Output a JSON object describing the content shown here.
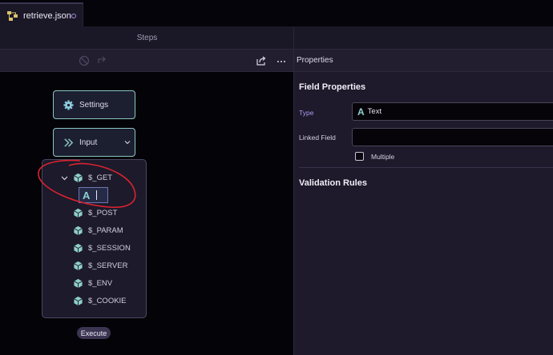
{
  "tab": {
    "title": "retrieve.json",
    "icon": "flow-icon"
  },
  "steps_panel": {
    "header": "Steps",
    "nodes": {
      "settings": {
        "label": "Settings",
        "icon": "gear-icon"
      },
      "input": {
        "label": "Input",
        "icon": "double-chevron-right-icon"
      }
    },
    "tree": {
      "expanded_item": "$_GET",
      "items": [
        "$_POST",
        "$_PARAM",
        "$_SESSION",
        "$_SERVER",
        "$_ENV",
        "$_COOKIE"
      ],
      "edit_icon_glyph": "A"
    },
    "execute_label": "Execute"
  },
  "properties_panel": {
    "title": "Properties",
    "field_properties": {
      "heading": "Field Properties",
      "type_label": "Type",
      "type_value": "Text",
      "type_glyph": "A",
      "linked_field_label": "Linked Field",
      "linked_field_value": "",
      "multiple_label": "Multiple",
      "multiple_checked": false
    },
    "validation_heading": "Validation Rules"
  },
  "colors": {
    "accent_teal": "#8cc6c2",
    "type_label_purple": "#a99af0",
    "annotation_red": "#d8232f"
  }
}
